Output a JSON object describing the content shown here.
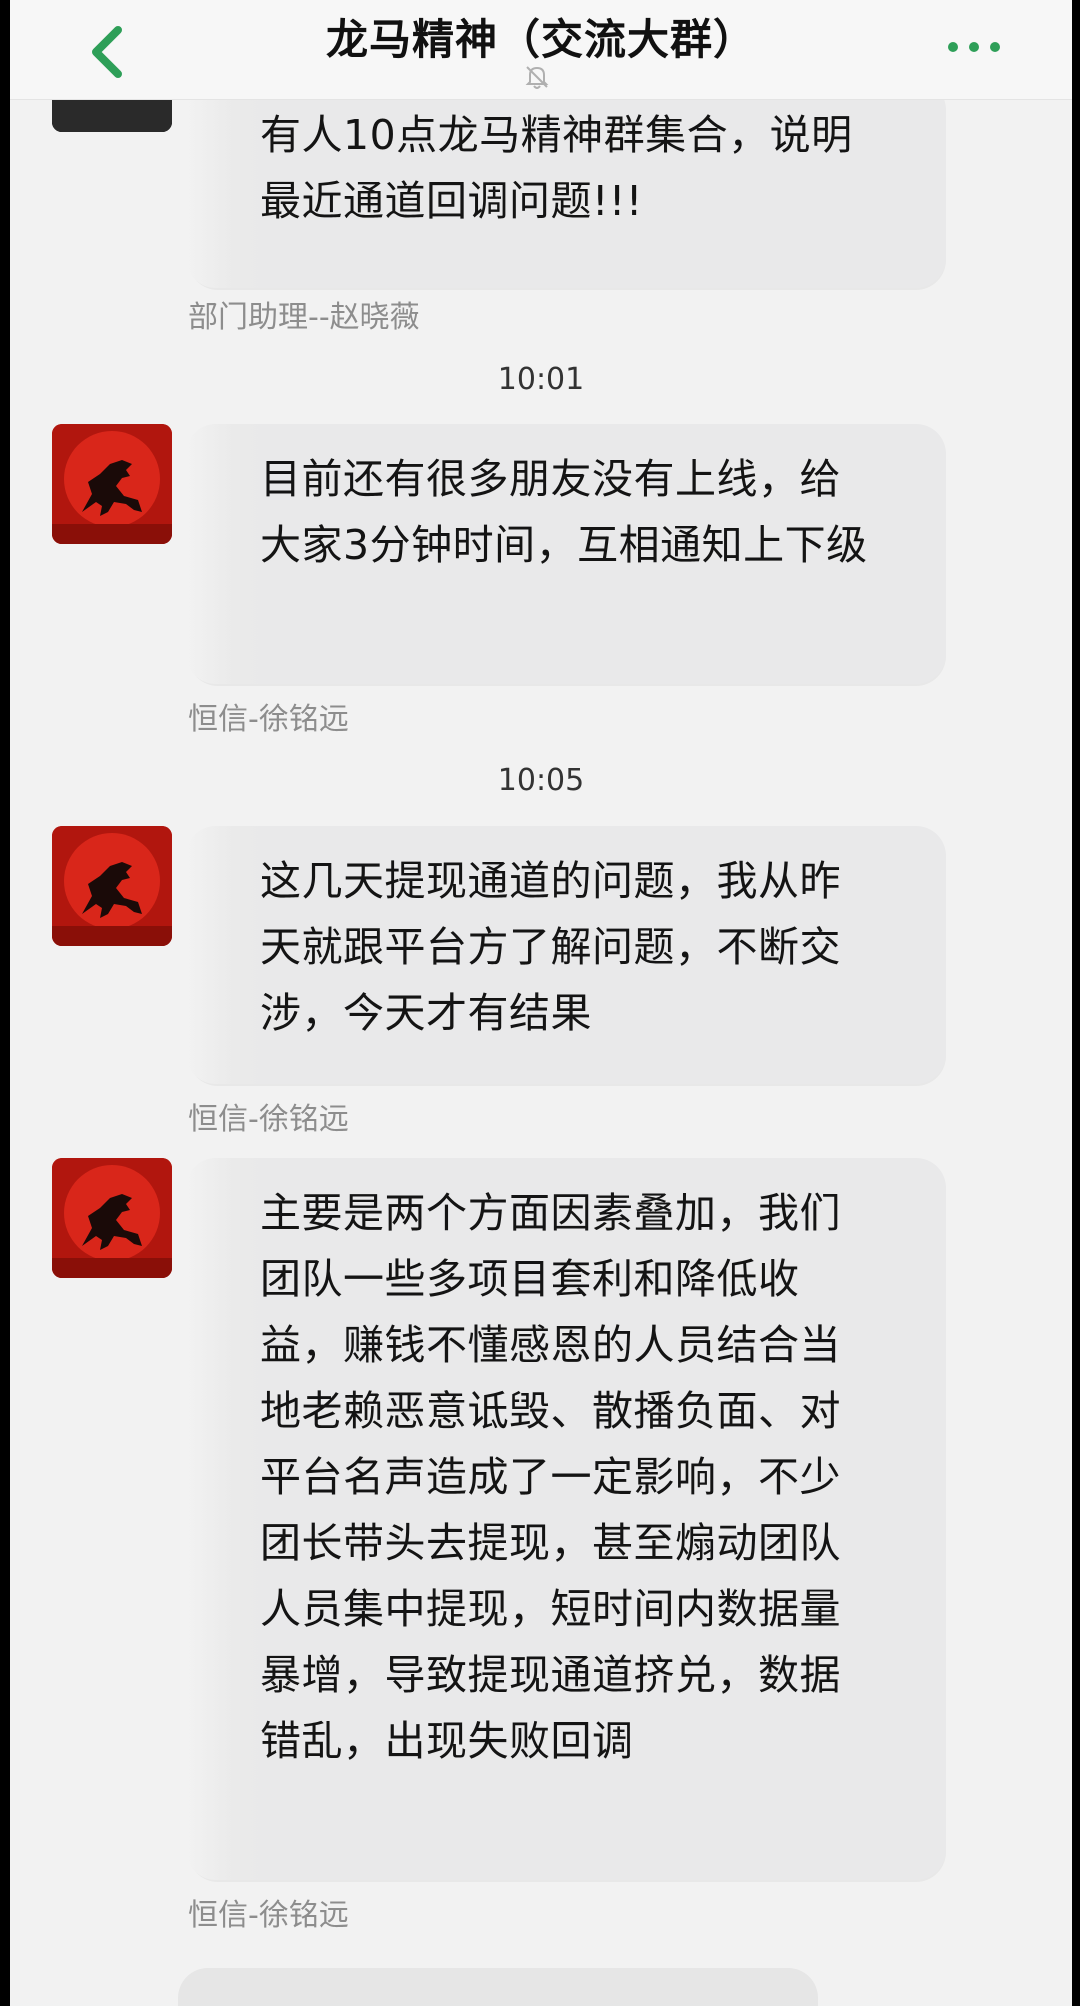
{
  "header": {
    "title": "龙马精神（交流大群）",
    "back_icon": "chevron-left-icon",
    "mute_icon": "bell-muted-icon",
    "more_icon": "more-dots-icon",
    "accent": "#2e9f58"
  },
  "messages": [
    {
      "text": "有人10点龙马精神群集合，说明最近通道回调问题!!!",
      "sender": "部门助理--赵晓薇"
    },
    {
      "time": "10:01",
      "text": "目前还有很多朋友没有上线，给大家3分钟时间，互相通知上下级",
      "sender": "恒信-徐铭远"
    },
    {
      "time": "10:05",
      "text": "这几天提现通道的问题，我从昨天就跟平台方了解问题，不断交涉，今天才有结果",
      "sender": "恒信-徐铭远"
    },
    {
      "text": "主要是两个方面因素叠加，我们团队一些多项目套利和降低收益，赚钱不懂感恩的人员结合当地老赖恶意诋毁、散播负面、对平台名声造成了一定影响，不少团长带头去提现，甚至煽动团队人员集中提现，短时间内数据量暴增，导致提现通道挤兑，数据错乱，出现失败回调",
      "sender": "恒信-徐铭远"
    }
  ]
}
